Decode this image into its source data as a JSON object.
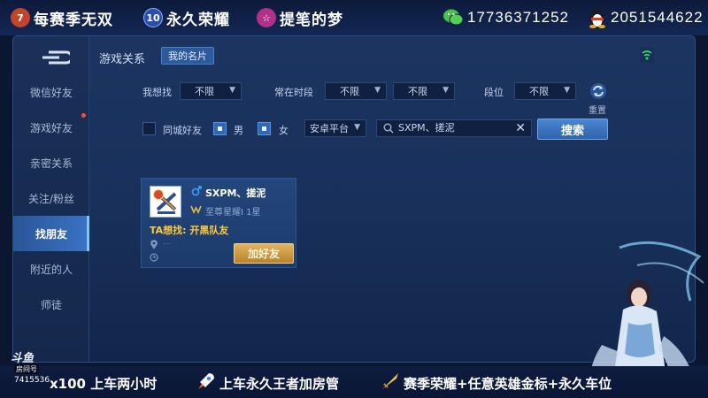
{
  "top_banner": {
    "item1": {
      "badge": "7",
      "text": "每赛季无双",
      "badge_color": "#c2452b",
      "icon": "rank-badge-icon"
    },
    "item2": {
      "badge": "10",
      "text": "永久荣耀",
      "badge_color": "#2b4fa8",
      "icon": "rank-badge-icon"
    },
    "item3": {
      "badge": "☆",
      "text": "提笔的梦",
      "badge_color": "#b0308a",
      "icon": "rank-badge-icon"
    },
    "wechat": {
      "icon": "wechat-icon",
      "number": "17736371252",
      "color": "#45c34a"
    },
    "qq": {
      "icon": "qq-penguin-icon",
      "number": "2051544622"
    }
  },
  "sidebar": {
    "back_icon": "back-arrow-icon",
    "items": [
      {
        "label": "微信好友",
        "active": false
      },
      {
        "label": "游戏好友",
        "active": false,
        "notification_dot": true
      },
      {
        "label": "亲密关系",
        "active": false
      },
      {
        "label": "关注/粉丝",
        "active": false
      },
      {
        "label": "找朋友",
        "active": true
      },
      {
        "label": "附近的人",
        "active": false
      },
      {
        "label": "师徒",
        "active": false
      }
    ]
  },
  "header": {
    "title": "游戏关系",
    "tab": "我的名片",
    "signal_icon": "wifi-signal-icon"
  },
  "filters": {
    "want_label": "我想找",
    "want_value": "不限",
    "online_label": "常在时段",
    "online_value1": "不限",
    "online_value2": "不限",
    "rank_label": "段位",
    "rank_value": "不限",
    "reset_label": "重置",
    "same_city_label": "同城好友",
    "same_city_checked": false,
    "male_label": "男",
    "male_checked": true,
    "female_label": "女",
    "female_checked": true,
    "platform_value": "安卓平台",
    "search_value": "SXPM、搓泥",
    "search_button": "搜索"
  },
  "result_card": {
    "name": "SXPM、搓泥",
    "gender_icon": "male-icon",
    "rank": "至尊星耀I 1星",
    "seeking": "TA想找: 开黑队友",
    "location": "·····",
    "add_button": "加好友"
  },
  "bottom_banner": {
    "text1": "x100 上车两小时",
    "text2": "上车永久王者加房管",
    "text3": "赛季荣耀+任意英雄金标+永久车位",
    "logo": "斗鱼",
    "room_label": "房间号",
    "room_number": "7415536"
  }
}
